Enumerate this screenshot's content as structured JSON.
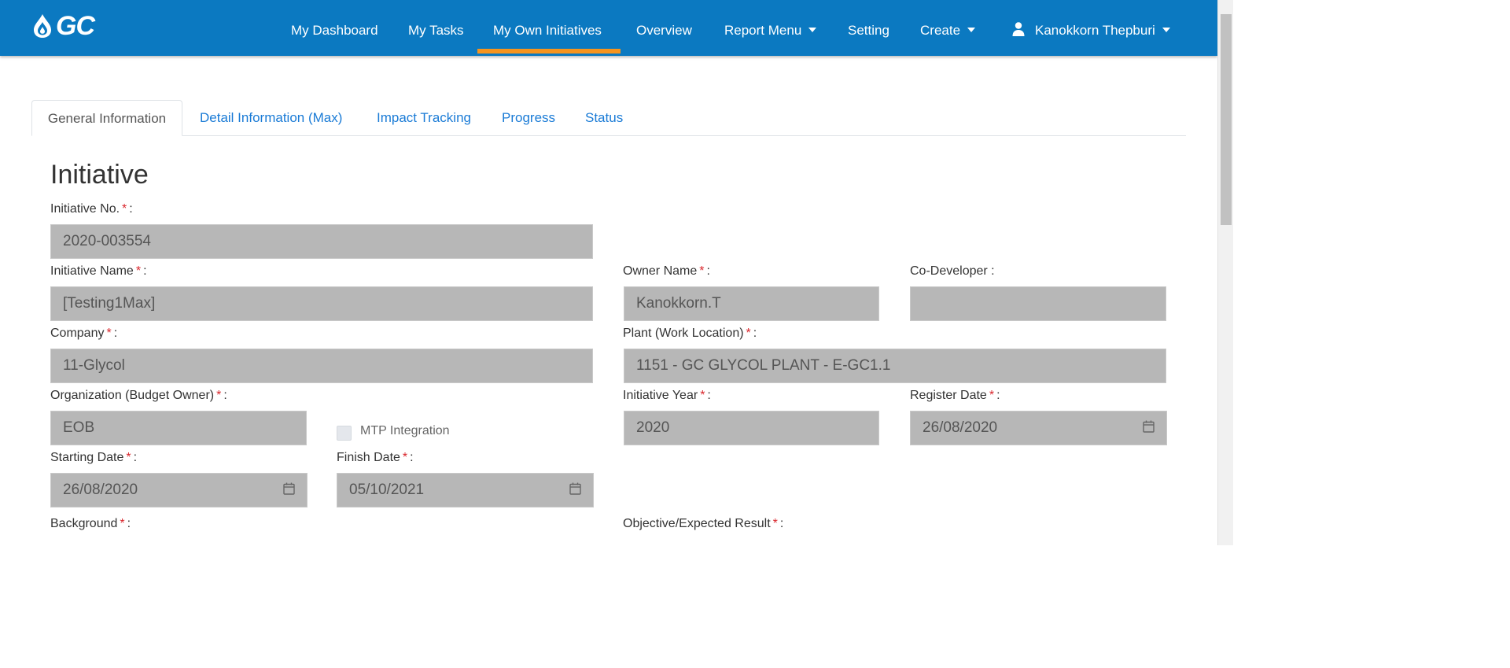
{
  "brand": {
    "logo_text": "GC"
  },
  "nav": {
    "items": [
      "My Dashboard",
      "My Tasks",
      "My Own Initiatives",
      "Overview",
      "Report Menu",
      "Setting",
      "Create"
    ],
    "active": "My Own Initiatives",
    "user": "Kanokkorn Thepburi"
  },
  "tabs": [
    "General Information",
    "Detail Information (Max)",
    "Impact Tracking",
    "Progress",
    "Status"
  ],
  "section_title": "Initiative",
  "form": {
    "initiative_no": {
      "label": "Initiative No.",
      "value": "2020-003554"
    },
    "initiative_name": {
      "label": "Initiative Name",
      "value": "[Testing1Max]"
    },
    "owner_name": {
      "label": "Owner Name",
      "value": "Kanokkorn.T"
    },
    "co_developer": {
      "label": "Co-Developer :",
      "value": ""
    },
    "company": {
      "label": "Company",
      "value": "11-Glycol"
    },
    "plant": {
      "label": "Plant (Work Location)",
      "value": "1151 - GC GLYCOL PLANT - E-GC1.1"
    },
    "organization": {
      "label": "Organization (Budget Owner)",
      "value": "EOB"
    },
    "mtp_integration": {
      "label": "MTP Integration",
      "checked": false
    },
    "initiative_year": {
      "label": "Initiative Year",
      "value": "2020"
    },
    "register_date": {
      "label": "Register Date",
      "value": "26/08/2020"
    },
    "starting_date": {
      "label": "Starting Date",
      "value": "26/08/2020"
    },
    "finish_date": {
      "label": "Finish Date",
      "value": "05/10/2021"
    },
    "background": {
      "label": "Background"
    },
    "objective": {
      "label": "Objective/Expected Result"
    }
  },
  "colors": {
    "navbar": "#0b79c1",
    "active_indicator": "#f7941d",
    "required": "#d9262c",
    "link": "#1a7bd6",
    "field_bg": "#b7b7b7"
  }
}
